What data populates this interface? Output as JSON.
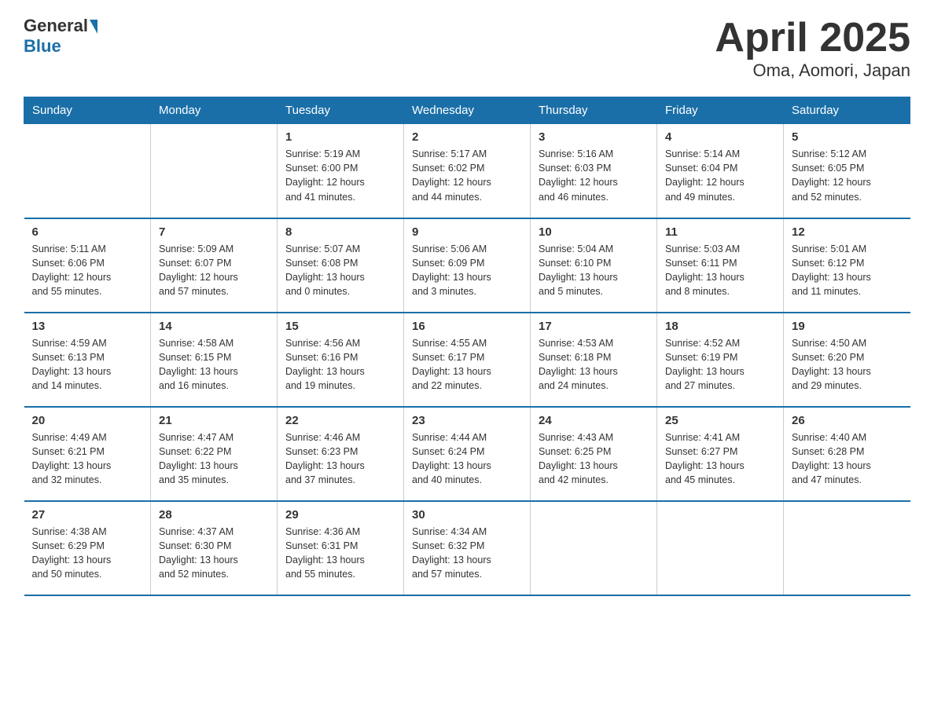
{
  "header": {
    "logo_general": "General",
    "logo_blue": "Blue",
    "title": "April 2025",
    "subtitle": "Oma, Aomori, Japan"
  },
  "days_of_week": [
    "Sunday",
    "Monday",
    "Tuesday",
    "Wednesday",
    "Thursday",
    "Friday",
    "Saturday"
  ],
  "weeks": [
    [
      {
        "num": "",
        "info": ""
      },
      {
        "num": "",
        "info": ""
      },
      {
        "num": "1",
        "info": "Sunrise: 5:19 AM\nSunset: 6:00 PM\nDaylight: 12 hours\nand 41 minutes."
      },
      {
        "num": "2",
        "info": "Sunrise: 5:17 AM\nSunset: 6:02 PM\nDaylight: 12 hours\nand 44 minutes."
      },
      {
        "num": "3",
        "info": "Sunrise: 5:16 AM\nSunset: 6:03 PM\nDaylight: 12 hours\nand 46 minutes."
      },
      {
        "num": "4",
        "info": "Sunrise: 5:14 AM\nSunset: 6:04 PM\nDaylight: 12 hours\nand 49 minutes."
      },
      {
        "num": "5",
        "info": "Sunrise: 5:12 AM\nSunset: 6:05 PM\nDaylight: 12 hours\nand 52 minutes."
      }
    ],
    [
      {
        "num": "6",
        "info": "Sunrise: 5:11 AM\nSunset: 6:06 PM\nDaylight: 12 hours\nand 55 minutes."
      },
      {
        "num": "7",
        "info": "Sunrise: 5:09 AM\nSunset: 6:07 PM\nDaylight: 12 hours\nand 57 minutes."
      },
      {
        "num": "8",
        "info": "Sunrise: 5:07 AM\nSunset: 6:08 PM\nDaylight: 13 hours\nand 0 minutes."
      },
      {
        "num": "9",
        "info": "Sunrise: 5:06 AM\nSunset: 6:09 PM\nDaylight: 13 hours\nand 3 minutes."
      },
      {
        "num": "10",
        "info": "Sunrise: 5:04 AM\nSunset: 6:10 PM\nDaylight: 13 hours\nand 5 minutes."
      },
      {
        "num": "11",
        "info": "Sunrise: 5:03 AM\nSunset: 6:11 PM\nDaylight: 13 hours\nand 8 minutes."
      },
      {
        "num": "12",
        "info": "Sunrise: 5:01 AM\nSunset: 6:12 PM\nDaylight: 13 hours\nand 11 minutes."
      }
    ],
    [
      {
        "num": "13",
        "info": "Sunrise: 4:59 AM\nSunset: 6:13 PM\nDaylight: 13 hours\nand 14 minutes."
      },
      {
        "num": "14",
        "info": "Sunrise: 4:58 AM\nSunset: 6:15 PM\nDaylight: 13 hours\nand 16 minutes."
      },
      {
        "num": "15",
        "info": "Sunrise: 4:56 AM\nSunset: 6:16 PM\nDaylight: 13 hours\nand 19 minutes."
      },
      {
        "num": "16",
        "info": "Sunrise: 4:55 AM\nSunset: 6:17 PM\nDaylight: 13 hours\nand 22 minutes."
      },
      {
        "num": "17",
        "info": "Sunrise: 4:53 AM\nSunset: 6:18 PM\nDaylight: 13 hours\nand 24 minutes."
      },
      {
        "num": "18",
        "info": "Sunrise: 4:52 AM\nSunset: 6:19 PM\nDaylight: 13 hours\nand 27 minutes."
      },
      {
        "num": "19",
        "info": "Sunrise: 4:50 AM\nSunset: 6:20 PM\nDaylight: 13 hours\nand 29 minutes."
      }
    ],
    [
      {
        "num": "20",
        "info": "Sunrise: 4:49 AM\nSunset: 6:21 PM\nDaylight: 13 hours\nand 32 minutes."
      },
      {
        "num": "21",
        "info": "Sunrise: 4:47 AM\nSunset: 6:22 PM\nDaylight: 13 hours\nand 35 minutes."
      },
      {
        "num": "22",
        "info": "Sunrise: 4:46 AM\nSunset: 6:23 PM\nDaylight: 13 hours\nand 37 minutes."
      },
      {
        "num": "23",
        "info": "Sunrise: 4:44 AM\nSunset: 6:24 PM\nDaylight: 13 hours\nand 40 minutes."
      },
      {
        "num": "24",
        "info": "Sunrise: 4:43 AM\nSunset: 6:25 PM\nDaylight: 13 hours\nand 42 minutes."
      },
      {
        "num": "25",
        "info": "Sunrise: 4:41 AM\nSunset: 6:27 PM\nDaylight: 13 hours\nand 45 minutes."
      },
      {
        "num": "26",
        "info": "Sunrise: 4:40 AM\nSunset: 6:28 PM\nDaylight: 13 hours\nand 47 minutes."
      }
    ],
    [
      {
        "num": "27",
        "info": "Sunrise: 4:38 AM\nSunset: 6:29 PM\nDaylight: 13 hours\nand 50 minutes."
      },
      {
        "num": "28",
        "info": "Sunrise: 4:37 AM\nSunset: 6:30 PM\nDaylight: 13 hours\nand 52 minutes."
      },
      {
        "num": "29",
        "info": "Sunrise: 4:36 AM\nSunset: 6:31 PM\nDaylight: 13 hours\nand 55 minutes."
      },
      {
        "num": "30",
        "info": "Sunrise: 4:34 AM\nSunset: 6:32 PM\nDaylight: 13 hours\nand 57 minutes."
      },
      {
        "num": "",
        "info": ""
      },
      {
        "num": "",
        "info": ""
      },
      {
        "num": "",
        "info": ""
      }
    ]
  ]
}
